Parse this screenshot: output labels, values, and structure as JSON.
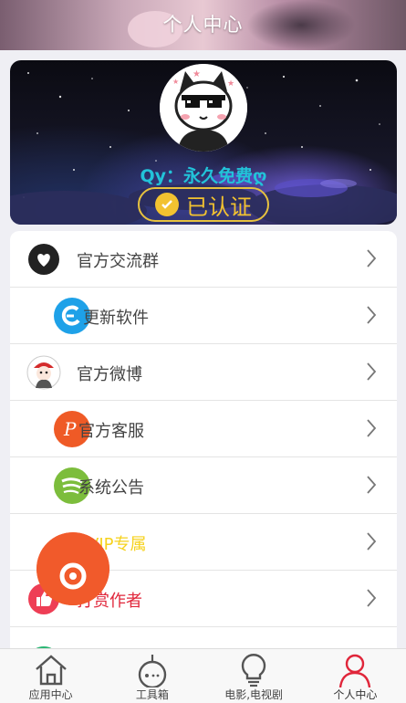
{
  "header": {
    "title": "个人中心"
  },
  "profile": {
    "name": "Qy：永久免费ღ",
    "verified_label": "已认证"
  },
  "menu": {
    "items": [
      {
        "label": "官方交流群",
        "icon": "heart-icon"
      },
      {
        "label": "更新软件",
        "icon": "update-icon"
      },
      {
        "label": "官方微博",
        "icon": "weibo-avatar-icon"
      },
      {
        "label": "官方客服",
        "icon": "service-icon"
      },
      {
        "label": "系统公告",
        "icon": "announcement-icon"
      },
      {
        "label": "VIP专属",
        "icon": "vip-icon"
      },
      {
        "label": "打赏作者",
        "icon": "thumbs-up-icon"
      }
    ]
  },
  "tabbar": {
    "tabs": [
      {
        "label": "应用中心",
        "icon": "home-icon"
      },
      {
        "label": "工具箱",
        "icon": "robot-icon"
      },
      {
        "label": "电影,电视剧",
        "icon": "bulb-icon"
      },
      {
        "label": "个人中心",
        "icon": "person-icon",
        "active": true
      }
    ]
  },
  "colors": {
    "accent_red": "#e0263a",
    "vip_yellow": "#f6d21e",
    "verified_gold": "#f2c230",
    "name_cyan": "#22c3d9"
  }
}
